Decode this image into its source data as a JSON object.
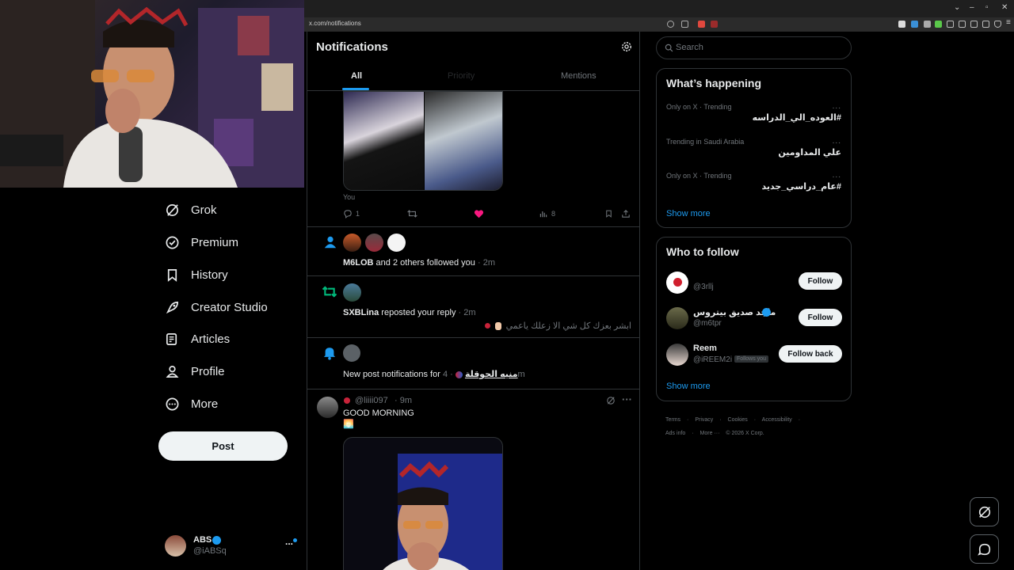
{
  "browser": {
    "url": "x.com/notifications"
  },
  "nav": {
    "items": [
      {
        "label": "Grok",
        "icon": "grok-icon"
      },
      {
        "label": "Premium",
        "icon": "premium-icon"
      },
      {
        "label": "History",
        "icon": "bookmark-icon"
      },
      {
        "label": "Creator Studio",
        "icon": "rocket-icon"
      },
      {
        "label": "Articles",
        "icon": "articles-icon"
      },
      {
        "label": "Profile",
        "icon": "profile-icon"
      },
      {
        "label": "More",
        "icon": "more-circle-icon"
      }
    ],
    "post_label": "Post",
    "account": {
      "name": "ABS",
      "handle": "@iABSq",
      "more": "..."
    }
  },
  "center": {
    "title": "Notifications",
    "tabs": [
      {
        "label": "All",
        "active": true
      },
      {
        "label": "Priority",
        "active": false
      },
      {
        "label": "Mentions",
        "active": false
      }
    ],
    "top_post": {
      "author_label": "You",
      "replies": "1",
      "views": "8"
    },
    "notifications": [
      {
        "type": "follow",
        "user": "M6LOB",
        "text": " and 2 others followed you",
        "time": "· 2m"
      },
      {
        "type": "repost",
        "user": "SXBLina",
        "text": " reposted your reply",
        "time": "· 2m",
        "quote": "ابشر بعزك كل شي الا زعلك ياعمي"
      },
      {
        "type": "new-post",
        "prefix": "New post notifications for ",
        "target": "منيه الحوقلة",
        "time": "· 4m"
      }
    ],
    "post": {
      "handle": "@liiii097",
      "time": "· 9m",
      "text": "GOOD MORNING",
      "emoji": "🌅"
    }
  },
  "right": {
    "search_placeholder": "Search",
    "happening": {
      "title": "What’s happening",
      "trends": [
        {
          "meta": "Only on X · Trending",
          "name": "#العوده_الي_الدراسه"
        },
        {
          "meta": "Trending in Saudi Arabia",
          "name": "علي المداومين"
        },
        {
          "meta": "Only on X · Trending",
          "name": "#عام_دراسي_جديد"
        }
      ],
      "more_glyph": "...",
      "show_more": "Show more"
    },
    "who_to_follow": {
      "title": "Who to follow",
      "users": [
        {
          "name": "",
          "handle": "@3rllj",
          "button": "Follow"
        },
        {
          "name": "ماجد صديق بيتروس",
          "handle": "@m6tpr",
          "button": "Follow"
        },
        {
          "name": "Reem",
          "handle": "@iREEM2i",
          "badge": "Follows you",
          "button": "Follow back"
        }
      ],
      "show_more": "Show more"
    },
    "footer": {
      "line1": [
        "Terms",
        "·",
        "Privacy",
        "·",
        "Cookies",
        "·",
        "Accessibility",
        "·"
      ],
      "line2": [
        "Ads info",
        "·",
        "More ···",
        "© 2026 X Corp."
      ]
    }
  },
  "colors": {
    "accent": "#1d9bf0",
    "like": "#f91880",
    "repost": "#00ba7c",
    "border": "#2f3336",
    "muted": "#71767b"
  }
}
